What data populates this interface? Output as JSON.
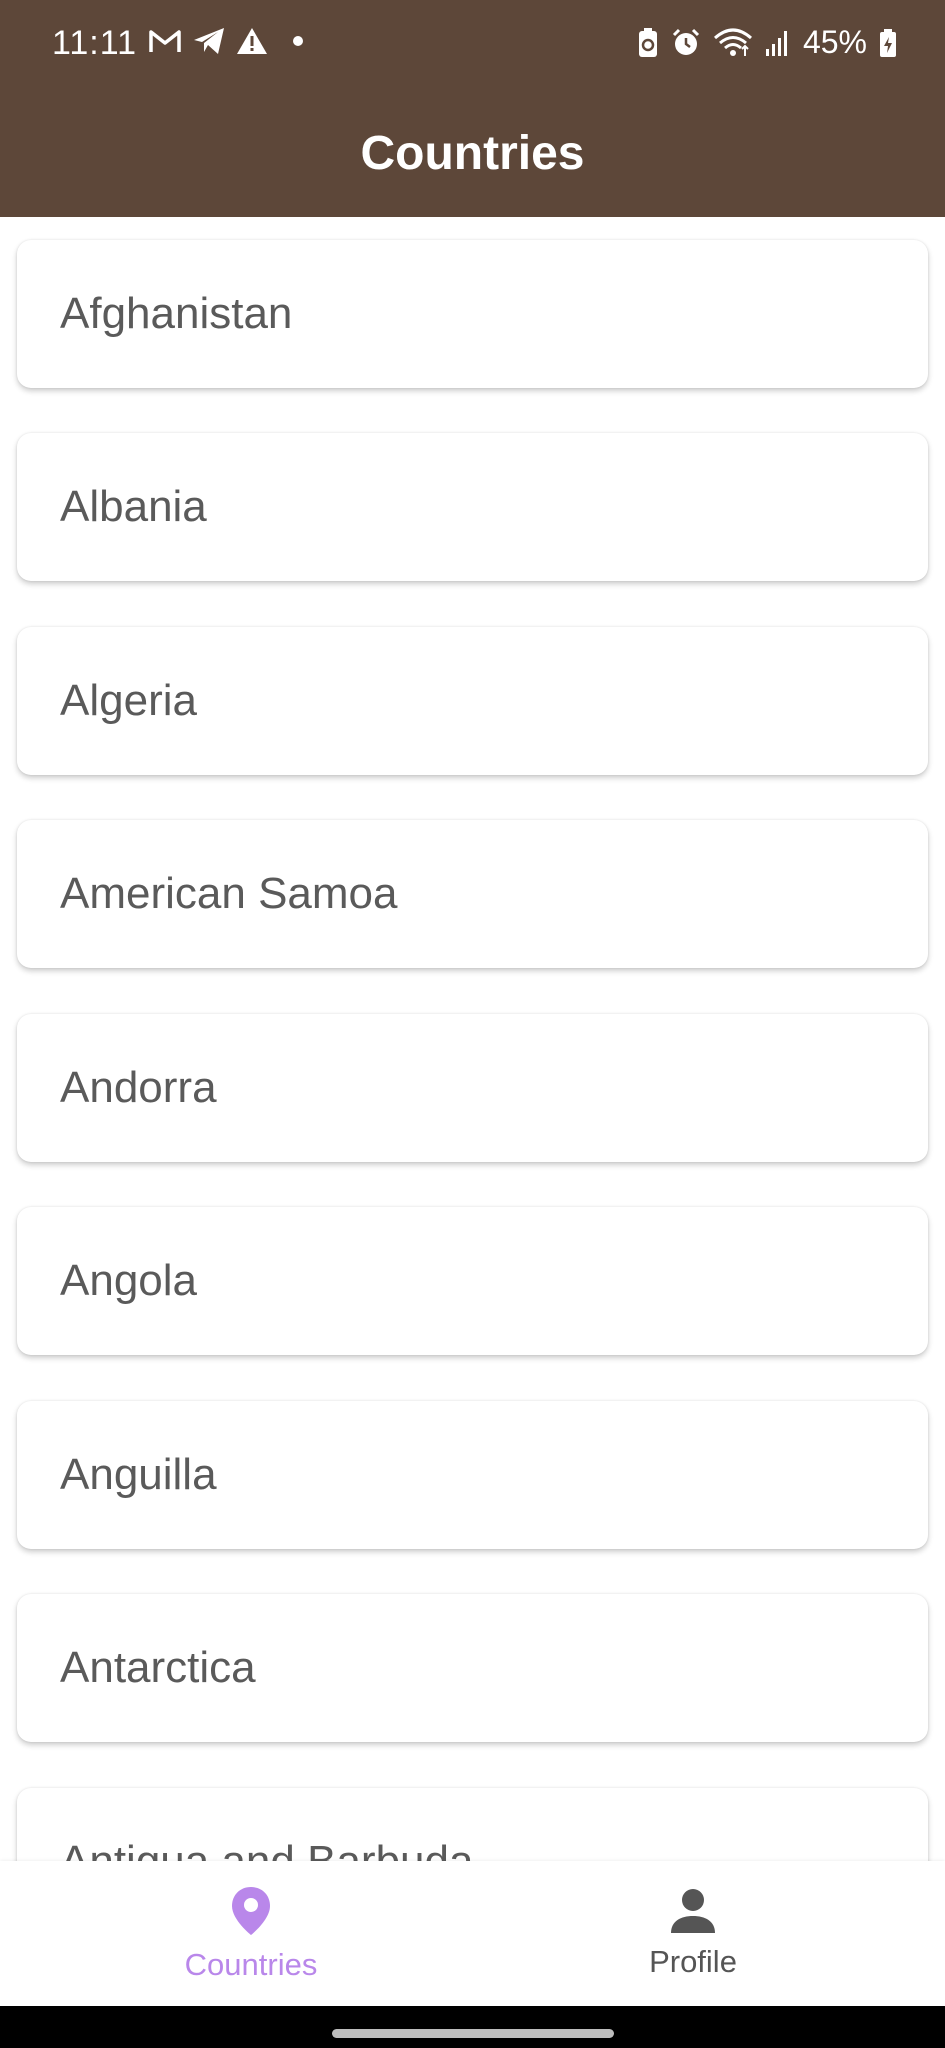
{
  "status_bar": {
    "time": "11:11",
    "battery": "45%"
  },
  "app_bar": {
    "title": "Countries"
  },
  "countries": [
    "Afghanistan",
    "Albania",
    "Algeria",
    "American Samoa",
    "Andorra",
    "Angola",
    "Anguilla",
    "Antarctica",
    "Antigua and Barbuda"
  ],
  "bottom_nav": {
    "items": [
      {
        "label": "Countries",
        "icon": "location-pin-icon",
        "active": true
      },
      {
        "label": "Profile",
        "icon": "person-icon",
        "active": false
      }
    ]
  },
  "colors": {
    "app_bar_bg": "#5d4739",
    "active_nav": "#b987ea",
    "inactive_nav": "#555555",
    "item_text": "#5a5a5a"
  }
}
